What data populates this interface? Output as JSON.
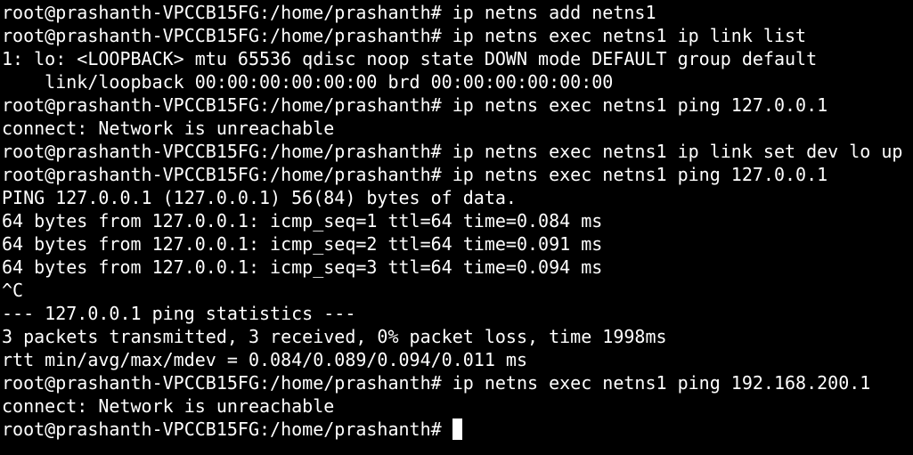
{
  "terminal": {
    "lines": [
      "root@prashanth-VPCCB15FG:/home/prashanth# ip netns add netns1",
      "root@prashanth-VPCCB15FG:/home/prashanth# ip netns exec netns1 ip link list",
      "1: lo: <LOOPBACK> mtu 65536 qdisc noop state DOWN mode DEFAULT group default",
      "    link/loopback 00:00:00:00:00:00 brd 00:00:00:00:00:00",
      "root@prashanth-VPCCB15FG:/home/prashanth# ip netns exec netns1 ping 127.0.0.1",
      "connect: Network is unreachable",
      "root@prashanth-VPCCB15FG:/home/prashanth# ip netns exec netns1 ip link set dev lo up",
      "root@prashanth-VPCCB15FG:/home/prashanth# ip netns exec netns1 ping 127.0.0.1",
      "PING 127.0.0.1 (127.0.0.1) 56(84) bytes of data.",
      "64 bytes from 127.0.0.1: icmp_seq=1 ttl=64 time=0.084 ms",
      "64 bytes from 127.0.0.1: icmp_seq=2 ttl=64 time=0.091 ms",
      "64 bytes from 127.0.0.1: icmp_seq=3 ttl=64 time=0.094 ms",
      "^C",
      "--- 127.0.0.1 ping statistics ---",
      "3 packets transmitted, 3 received, 0% packet loss, time 1998ms",
      "rtt min/avg/max/mdev = 0.084/0.089/0.094/0.011 ms",
      "root@prashanth-VPCCB15FG:/home/prashanth# ip netns exec netns1 ping 192.168.200.1",
      "connect: Network is unreachable"
    ],
    "prompt": "root@prashanth-VPCCB15FG:/home/prashanth#",
    "colors": {
      "background": "#000000",
      "foreground": "#ffffff",
      "cursor": "#ffffff"
    }
  }
}
